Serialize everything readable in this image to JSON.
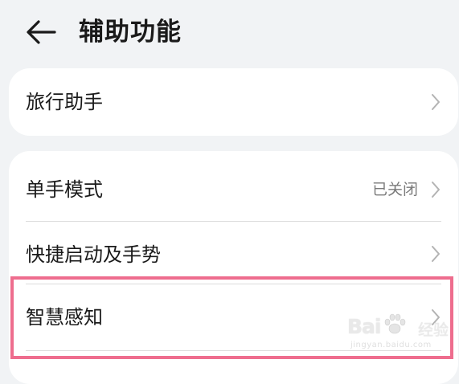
{
  "header": {
    "title": "辅助功能"
  },
  "colors": {
    "background": "#f1f3f5",
    "card": "#ffffff",
    "highlight": "#ee6d8e",
    "secondary_text": "#7a7a7a"
  },
  "icons": {
    "back": "arrow-left-icon",
    "chevron": "chevron-right-icon"
  },
  "group1": {
    "items": [
      {
        "label": "旅行助手",
        "value": ""
      }
    ]
  },
  "group2": {
    "items": [
      {
        "label": "单手模式",
        "value": "已关闭"
      },
      {
        "label": "快捷启动及手势",
        "value": ""
      },
      {
        "label": "智慧感知",
        "value": ""
      }
    ]
  },
  "watermark": {
    "logo_text": "Bai",
    "brand_cn": "经验",
    "url": "jingyan.baidu.com"
  }
}
